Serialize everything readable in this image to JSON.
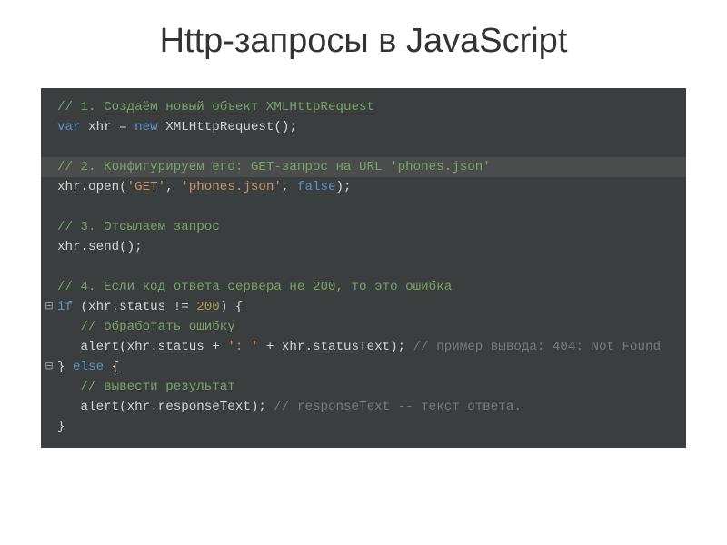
{
  "title": "Http-запросы в JavaScript",
  "code": {
    "c1": "// 1. Создаём новый объект XMLHttpRequest",
    "l2_var": "var",
    "l2_xhr": "xhr",
    "l2_eq": " = ",
    "l2_new": "new",
    "l2_ctor": " XMLHttpRequest",
    "l2_paren": "();",
    "c2": "// 2. Конфигурируем его: GET-запрос на URL 'phones.json'",
    "l4_open": "xhr.open(",
    "l4_get": "'GET'",
    "l4_comma1": ", ",
    "l4_url": "'phones.json'",
    "l4_comma2": ", ",
    "l4_false": "false",
    "l4_close": ");",
    "c3": "// 3. Отсылаем запрос",
    "l6_send": "xhr.send();",
    "c4": "// 4. Если код ответа сервера не 200, то это ошибка",
    "l8_if": "if",
    "l8_cond1": " (xhr.status != ",
    "l8_200": "200",
    "l8_cond2": ") {",
    "c5": "// обработать ошибку",
    "l10_a": "alert(xhr.status + ",
    "l10_s1": "': '",
    "l10_b": " + xhr.statusText); ",
    "c6": "// пример вывода: 404: Not Found",
    "l11_else": "} ",
    "l11_elsekw": "else",
    "l11_brace": " {",
    "c7": "// вывести результат",
    "l13_a": "alert(xhr.responseText); ",
    "c8": "// responseText -- текст ответа.",
    "l14_close": "}",
    "fold_minus": "⊟",
    "indent1": "   ",
    "indent2": "      "
  }
}
